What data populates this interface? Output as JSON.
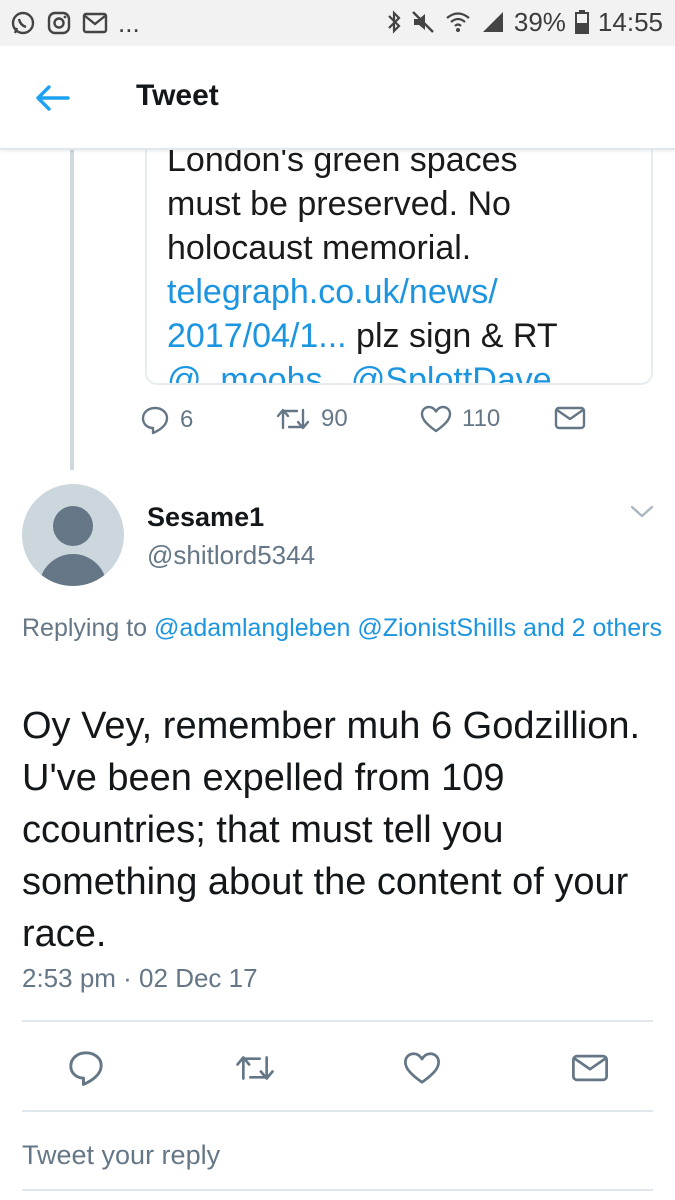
{
  "status_bar": {
    "battery": "39%",
    "time": "14:55",
    "more": "..."
  },
  "header": {
    "title": "Tweet"
  },
  "quoted": {
    "lines": [
      {
        "text": "London's green spaces"
      },
      {
        "text": "must be preserved. No"
      },
      {
        "text": "holocaust memorial."
      },
      {
        "link": "telegraph.co.uk/news/"
      },
      {
        "link": "2017/04/1...",
        "text": " plz sign & RT"
      },
      {
        "link": "@_moohs_ @SplottDave"
      }
    ],
    "actions": {
      "replies": "6",
      "retweets": "90",
      "likes": "110"
    }
  },
  "reply": {
    "display_name": "Sesame1",
    "handle": "@shitlord5344",
    "replying_prefix": "Replying to ",
    "replying_mentions": "@adamlangleben @ZionistShills and 2 others",
    "body": "Oy Vey, remember muh 6 Godzillion. U've been expelled from 109 ccountries; that must tell you something about the content of your race.",
    "timestamp": "2:53 pm · 02 Dec 17"
  },
  "composer": {
    "placeholder": "Tweet your reply"
  },
  "colors": {
    "link": "#1b95e0",
    "muted": "#657786",
    "text": "#14171a"
  }
}
